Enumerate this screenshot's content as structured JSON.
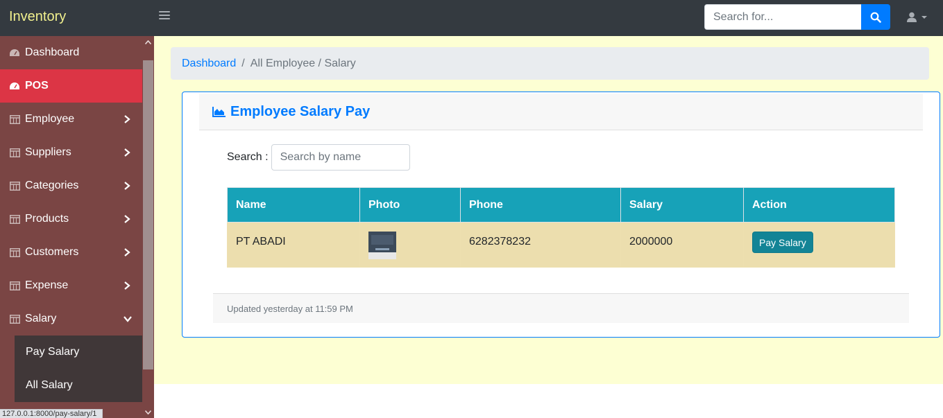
{
  "app": {
    "brand": "Inventory"
  },
  "navbar": {
    "search_placeholder": "Search for...",
    "search_icon": "search-icon",
    "user_icon": "user-icon"
  },
  "sidebar": {
    "items": [
      {
        "label": "Dashboard",
        "icon": "gauge-icon",
        "active": false,
        "has_chevron": false
      },
      {
        "label": "POS",
        "icon": "gauge-icon",
        "active": true,
        "has_chevron": false
      },
      {
        "label": "Employee",
        "icon": "table-icon",
        "active": false,
        "has_chevron": true
      },
      {
        "label": "Suppliers",
        "icon": "table-icon",
        "active": false,
        "has_chevron": true
      },
      {
        "label": "Categories",
        "icon": "table-icon",
        "active": false,
        "has_chevron": true
      },
      {
        "label": "Products",
        "icon": "table-icon",
        "active": false,
        "has_chevron": true
      },
      {
        "label": "Customers",
        "icon": "table-icon",
        "active": false,
        "has_chevron": true
      },
      {
        "label": "Expense",
        "icon": "table-icon",
        "active": false,
        "has_chevron": true
      },
      {
        "label": "Salary",
        "icon": "table-icon",
        "active": false,
        "has_chevron": true,
        "expanded": true
      }
    ],
    "salary_submenu": [
      "Pay Salary",
      "All Salary"
    ]
  },
  "breadcrumb": {
    "link": "Dashboard",
    "separator": "/",
    "current": "All Employee / Salary"
  },
  "card": {
    "title": "Employee Salary Pay",
    "title_icon": "area-chart-icon",
    "search_label": "Search :",
    "search_placeholder": "Search by name",
    "table": {
      "headers": [
        "Name",
        "Photo",
        "Phone",
        "Salary",
        "Action"
      ],
      "rows": [
        {
          "name": "PT ABADI",
          "photo": "employee-photo",
          "phone": "6282378232",
          "salary": "2000000",
          "action": "Pay Salary"
        }
      ]
    },
    "footer": "Updated yesterday at 11:59 PM"
  },
  "status_bar": {
    "url": "127.0.0.1:8000/pay-salary/1"
  },
  "colors": {
    "navbar": "#343a40",
    "brand": "#f1f08e",
    "sidebar": "#7a4544",
    "sidebar_active": "#dc3545",
    "submenu": "#403738",
    "main_bg": "#fdffd3",
    "primary": "#007bff",
    "table_header": "#17a2b8",
    "table_row": "#ecdeae",
    "pay_button": "#138496"
  }
}
